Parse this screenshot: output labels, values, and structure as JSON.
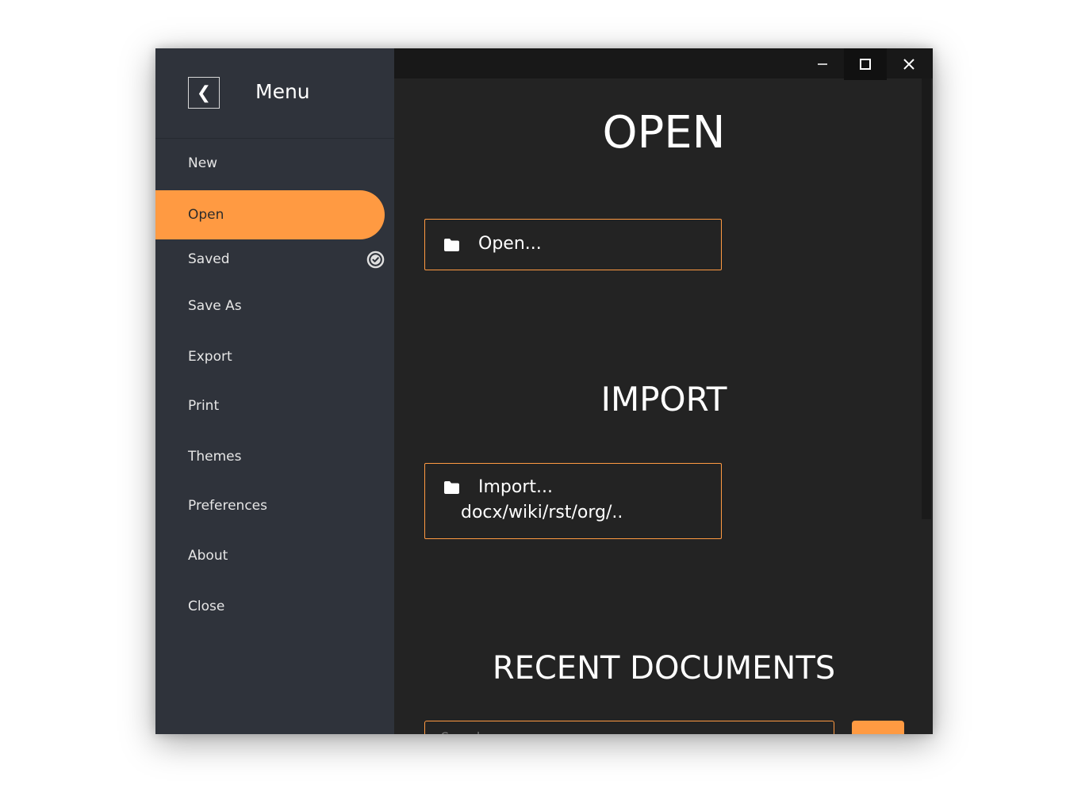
{
  "sidebar": {
    "back_icon": "chevron-left-icon",
    "back_glyph": "❮",
    "title": "Menu",
    "items": [
      {
        "label": "New"
      },
      {
        "label": "Open",
        "active": true
      },
      {
        "label": "Saved",
        "status_icon": "check-circle-icon"
      },
      {
        "label": "Save As"
      },
      {
        "label": "Export"
      },
      {
        "label": "Print"
      },
      {
        "label": "Themes"
      },
      {
        "label": "Preferences"
      },
      {
        "label": "About"
      },
      {
        "label": "Close"
      }
    ]
  },
  "window_controls": {
    "minimize_icon": "minimize-icon",
    "maximize_icon": "maximize-icon",
    "close_icon": "close-icon"
  },
  "main": {
    "open_section": {
      "heading": "OPEN",
      "button_label": "Open...",
      "button_icon": "folder-icon"
    },
    "import_section": {
      "heading": "IMPORT",
      "button_label": "Import...",
      "button_sublabel": "docx/wiki/rst/org/..",
      "button_icon": "folder-icon"
    },
    "recent_section": {
      "heading": "RECENT DOCUMENTS",
      "search_placeholder": "Search"
    }
  },
  "colors": {
    "accent": "#ff9a42",
    "sidebar_bg": "#2f333b",
    "content_bg": "#232323",
    "titlebar_bg": "#181818"
  }
}
